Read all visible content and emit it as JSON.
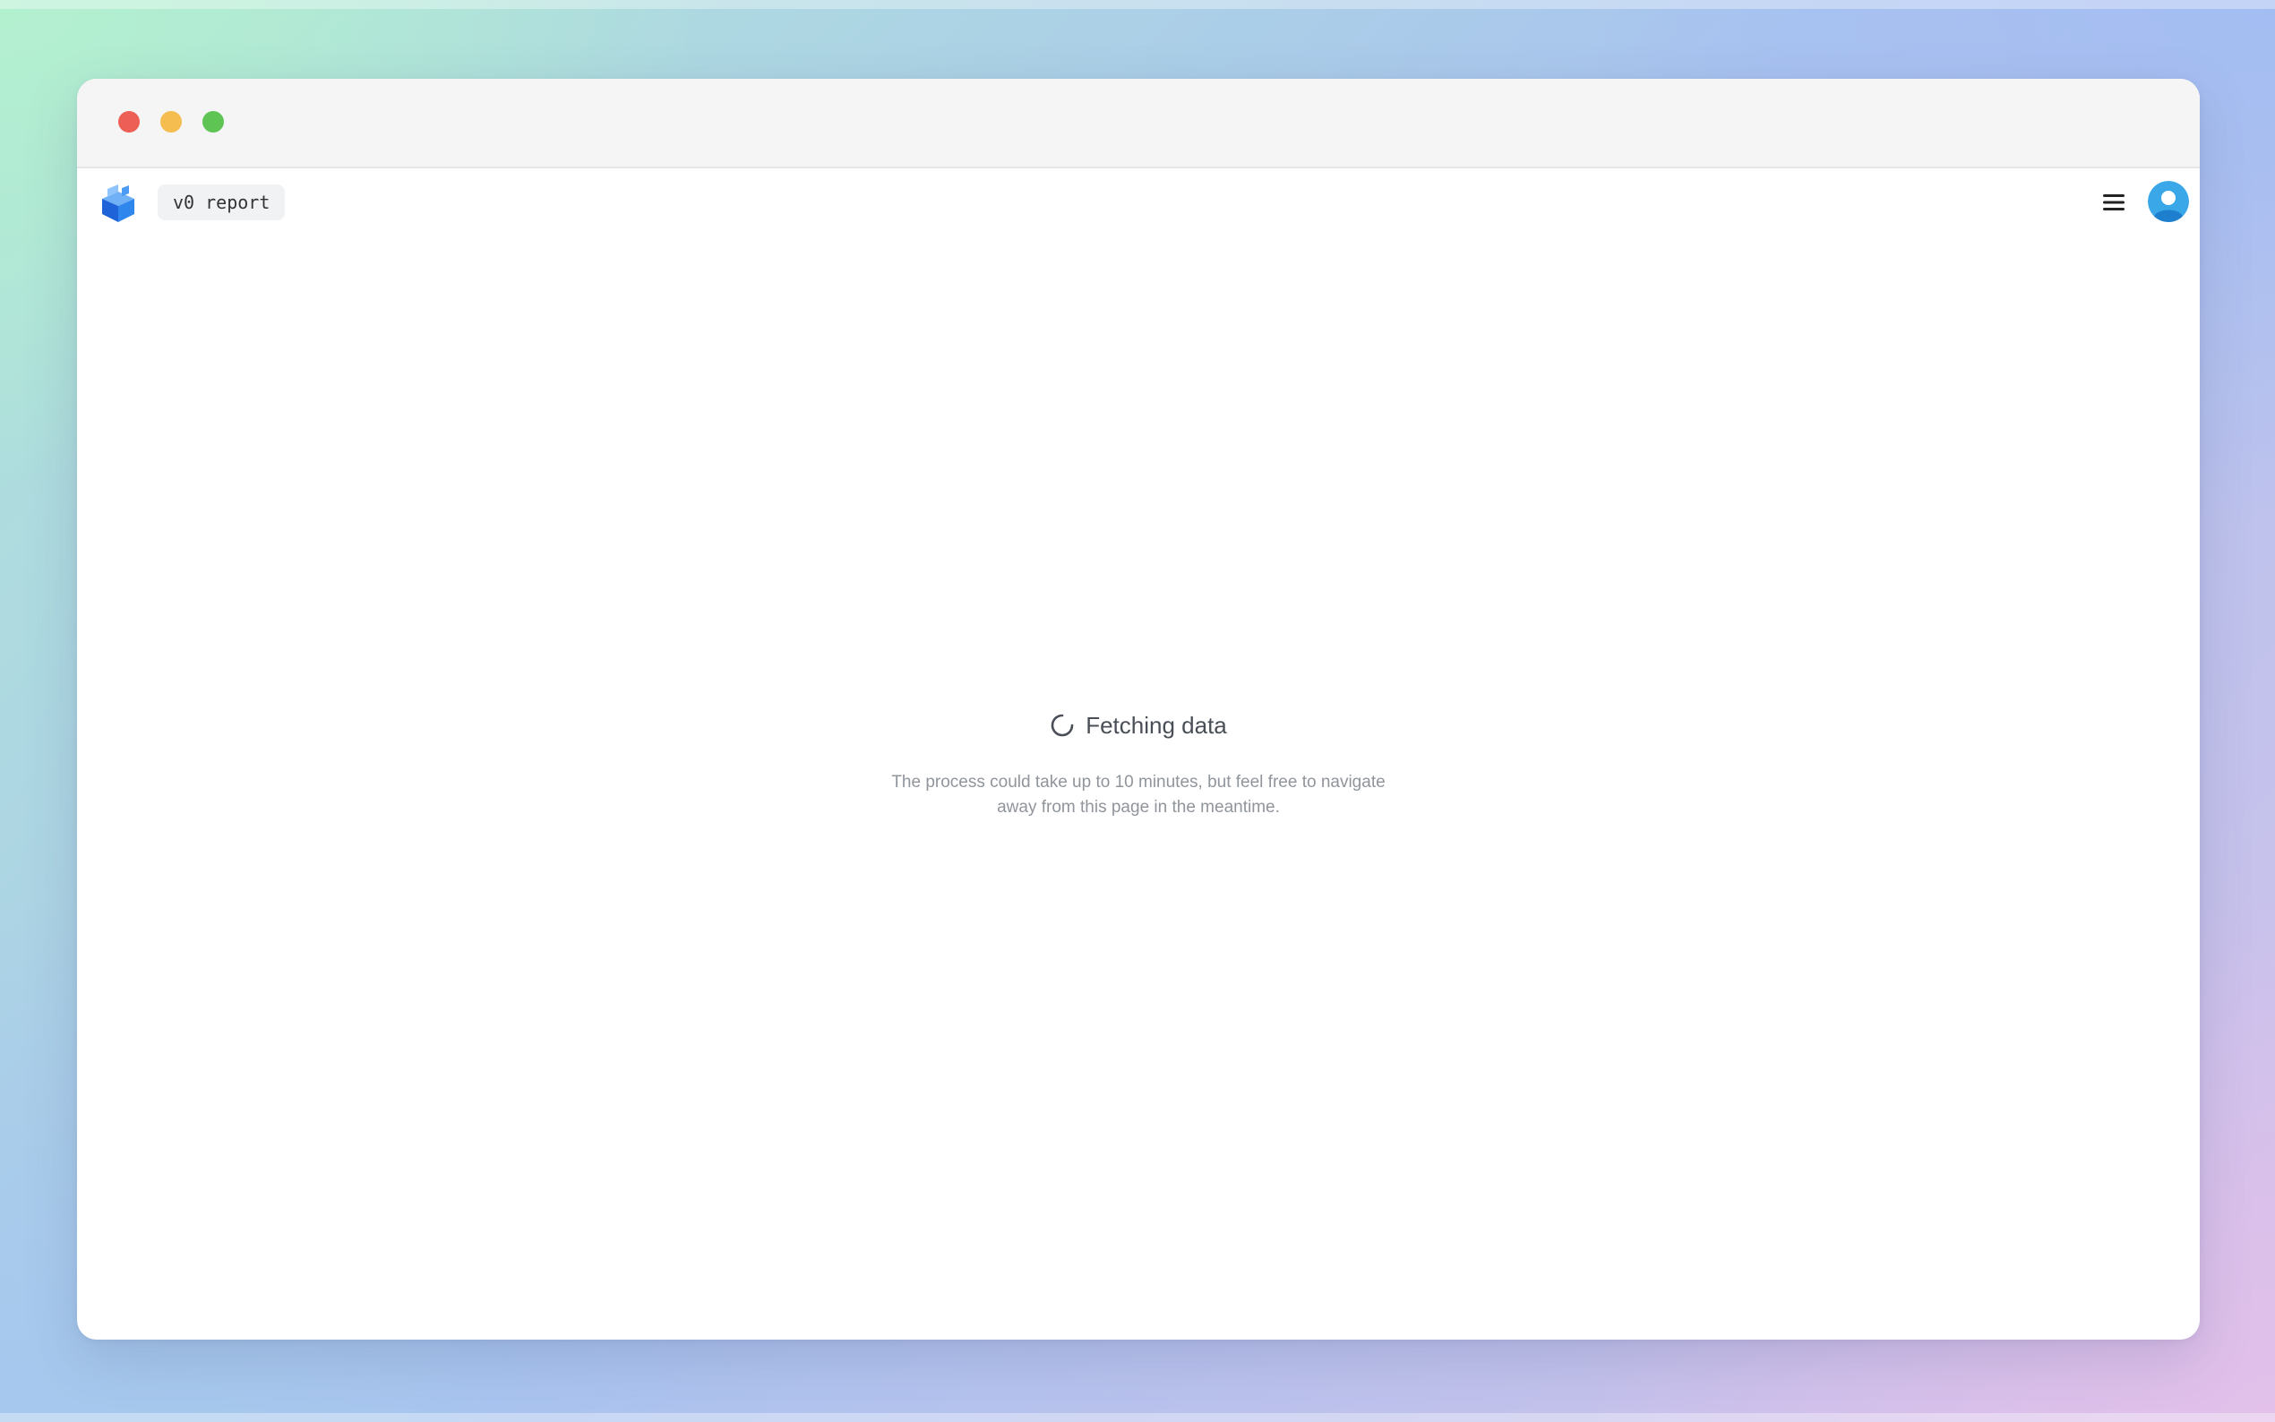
{
  "window": {
    "traffic_lights": [
      "close",
      "minimize",
      "maximize"
    ]
  },
  "appbar": {
    "logo_icon": "blue-cube-logo",
    "report_label": "v0 report",
    "menu_icon": "hamburger-menu-icon",
    "avatar_icon": "user-avatar-icon"
  },
  "status": {
    "spinner_icon": "loading-spinner-icon",
    "title": "Fetching data",
    "description": "The process could take up to 10 minutes, but feel free to navigate away from this page in the meantime."
  },
  "colors": {
    "accent_blue": "#2d7be5",
    "avatar_blue": "#3aa7e8",
    "close": "#ed5f56",
    "minimize": "#f5bd4f",
    "maximize": "#5ec453"
  }
}
